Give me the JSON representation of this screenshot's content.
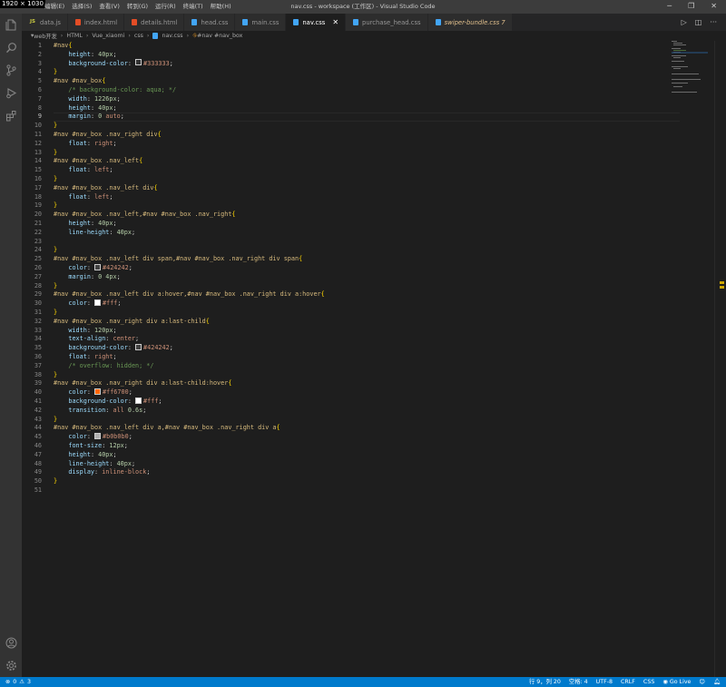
{
  "titlebar": {
    "dims_badge": "1920 × 1030",
    "menu": [
      "编辑(E)",
      "选择(S)",
      "查看(V)",
      "转到(G)",
      "运行(R)",
      "终端(T)",
      "帮助(H)"
    ],
    "window_title": "nav.css - workspace (工作区) - Visual Studio Code"
  },
  "tabs": [
    {
      "label": "data.js",
      "type": "js"
    },
    {
      "label": "index.html",
      "type": "html"
    },
    {
      "label": "details.html",
      "type": "html"
    },
    {
      "label": "head.css",
      "type": "css"
    },
    {
      "label": "main.css",
      "type": "css"
    },
    {
      "label": "nav.css",
      "type": "css",
      "active": true
    },
    {
      "label": "purchase_head.css",
      "type": "css"
    },
    {
      "label": "swiper-bundle.css 7",
      "type": "css",
      "modified": true
    }
  ],
  "breadcrumb": [
    "web开发",
    "HTML",
    "Vue_xiaomi",
    "css",
    "nav.css",
    "#nav #nav_box"
  ],
  "editor": {
    "current_line": 9,
    "lines": [
      [
        [
          "sel",
          "#nav"
        ],
        [
          "br",
          "{"
        ]
      ],
      [
        [
          "p",
          "    "
        ],
        [
          "prop",
          "height"
        ],
        [
          "p",
          ": "
        ],
        [
          "num",
          "40px"
        ],
        [
          "p",
          ";"
        ]
      ],
      [
        [
          "p",
          "    "
        ],
        [
          "prop",
          "background-color"
        ],
        [
          "p",
          ": "
        ],
        [
          "sw",
          "#333333"
        ],
        [
          "kw",
          "#333333"
        ],
        [
          "p",
          ";"
        ]
      ],
      [
        [
          "br",
          "}"
        ]
      ],
      [
        [
          "sel",
          "#nav #nav_box"
        ],
        [
          "br",
          "{"
        ]
      ],
      [
        [
          "p",
          "    "
        ],
        [
          "com",
          "/* background-color: aqua; */"
        ]
      ],
      [
        [
          "p",
          "    "
        ],
        [
          "prop",
          "width"
        ],
        [
          "p",
          ": "
        ],
        [
          "num",
          "1226px"
        ],
        [
          "p",
          ";"
        ]
      ],
      [
        [
          "p",
          "    "
        ],
        [
          "prop",
          "height"
        ],
        [
          "p",
          ": "
        ],
        [
          "num",
          "40px"
        ],
        [
          "p",
          ";"
        ]
      ],
      [
        [
          "p",
          "    "
        ],
        [
          "prop",
          "margin"
        ],
        [
          "p",
          ": "
        ],
        [
          "num",
          "0"
        ],
        [
          "p",
          " "
        ],
        [
          "kw",
          "auto"
        ],
        [
          "p",
          ";"
        ]
      ],
      [
        [
          "br",
          "}"
        ]
      ],
      [
        [
          "sel",
          "#nav #nav_box .nav_right div"
        ],
        [
          "br",
          "{"
        ]
      ],
      [
        [
          "p",
          "    "
        ],
        [
          "prop",
          "float"
        ],
        [
          "p",
          ": "
        ],
        [
          "kw",
          "right"
        ],
        [
          "p",
          ";"
        ]
      ],
      [
        [
          "br",
          "}"
        ]
      ],
      [
        [
          "sel",
          "#nav #nav_box .nav_left"
        ],
        [
          "br",
          "{"
        ]
      ],
      [
        [
          "p",
          "    "
        ],
        [
          "prop",
          "float"
        ],
        [
          "p",
          ": "
        ],
        [
          "kw",
          "left"
        ],
        [
          "p",
          ";"
        ]
      ],
      [
        [
          "br",
          "}"
        ]
      ],
      [
        [
          "sel",
          "#nav #nav_box .nav_left div"
        ],
        [
          "br",
          "{"
        ]
      ],
      [
        [
          "p",
          "    "
        ],
        [
          "prop",
          "float"
        ],
        [
          "p",
          ": "
        ],
        [
          "kw",
          "left"
        ],
        [
          "p",
          ";"
        ]
      ],
      [
        [
          "br",
          "}"
        ]
      ],
      [
        [
          "sel",
          "#nav #nav_box .nav_left,#nav #nav_box .nav_right"
        ],
        [
          "br",
          "{"
        ]
      ],
      [
        [
          "p",
          "    "
        ],
        [
          "prop",
          "height"
        ],
        [
          "p",
          ": "
        ],
        [
          "num",
          "40px"
        ],
        [
          "p",
          ";"
        ]
      ],
      [
        [
          "p",
          "    "
        ],
        [
          "prop",
          "line-height"
        ],
        [
          "p",
          ": "
        ],
        [
          "num",
          "40px"
        ],
        [
          "p",
          ";"
        ]
      ],
      [],
      [
        [
          "br",
          "}"
        ]
      ],
      [
        [
          "sel",
          "#nav #nav_box .nav_left div span,#nav #nav_box .nav_right div span"
        ],
        [
          "br",
          "{"
        ]
      ],
      [
        [
          "p",
          "    "
        ],
        [
          "prop",
          "color"
        ],
        [
          "p",
          ": "
        ],
        [
          "sw",
          "#424242"
        ],
        [
          "kw",
          "#424242"
        ],
        [
          "p",
          ";"
        ]
      ],
      [
        [
          "p",
          "    "
        ],
        [
          "prop",
          "margin"
        ],
        [
          "p",
          ": "
        ],
        [
          "num",
          "0 4px"
        ],
        [
          "p",
          ";"
        ]
      ],
      [
        [
          "br",
          "}"
        ]
      ],
      [
        [
          "sel",
          "#nav #nav_box .nav_left div a:hover,#nav #nav_box .nav_right div a:hover"
        ],
        [
          "br",
          "{"
        ]
      ],
      [
        [
          "p",
          "    "
        ],
        [
          "prop",
          "color"
        ],
        [
          "p",
          ": "
        ],
        [
          "sw",
          "#ffffff"
        ],
        [
          "kw",
          "#fff"
        ],
        [
          "p",
          ";"
        ]
      ],
      [
        [
          "br",
          "}"
        ]
      ],
      [
        [
          "sel",
          "#nav #nav_box .nav_right div a:last-child"
        ],
        [
          "br",
          "{"
        ]
      ],
      [
        [
          "p",
          "    "
        ],
        [
          "prop",
          "width"
        ],
        [
          "p",
          ": "
        ],
        [
          "num",
          "120px"
        ],
        [
          "p",
          ";"
        ]
      ],
      [
        [
          "p",
          "    "
        ],
        [
          "prop",
          "text-align"
        ],
        [
          "p",
          ": "
        ],
        [
          "kw",
          "center"
        ],
        [
          "p",
          ";"
        ]
      ],
      [
        [
          "p",
          "    "
        ],
        [
          "prop",
          "background-color"
        ],
        [
          "p",
          ": "
        ],
        [
          "sw",
          "#424242"
        ],
        [
          "kw",
          "#424242"
        ],
        [
          "p",
          ";"
        ]
      ],
      [
        [
          "p",
          "    "
        ],
        [
          "prop",
          "float"
        ],
        [
          "p",
          ": "
        ],
        [
          "kw",
          "right"
        ],
        [
          "p",
          ";"
        ]
      ],
      [
        [
          "p",
          "    "
        ],
        [
          "com",
          "/* overflow: hidden; */"
        ]
      ],
      [
        [
          "br",
          "}"
        ]
      ],
      [
        [
          "sel",
          "#nav #nav_box .nav_right div a:last-child:hover"
        ],
        [
          "br",
          "{"
        ]
      ],
      [
        [
          "p",
          "    "
        ],
        [
          "prop",
          "color"
        ],
        [
          "p",
          ": "
        ],
        [
          "sw",
          "#ff6700"
        ],
        [
          "kw",
          "#ff6700"
        ],
        [
          "p",
          ";"
        ]
      ],
      [
        [
          "p",
          "    "
        ],
        [
          "prop",
          "background-color"
        ],
        [
          "p",
          ": "
        ],
        [
          "sw",
          "#ffffff"
        ],
        [
          "kw",
          "#fff"
        ],
        [
          "p",
          ";"
        ]
      ],
      [
        [
          "p",
          "    "
        ],
        [
          "prop",
          "transition"
        ],
        [
          "p",
          ": "
        ],
        [
          "kw",
          "all "
        ],
        [
          "num",
          "0.6s"
        ],
        [
          "p",
          ";"
        ]
      ],
      [
        [
          "br",
          "}"
        ]
      ],
      [
        [
          "sel",
          "#nav #nav_box .nav_left div a,#nav #nav_box .nav_right div a"
        ],
        [
          "br",
          "{"
        ]
      ],
      [
        [
          "p",
          "    "
        ],
        [
          "prop",
          "color"
        ],
        [
          "p",
          ": "
        ],
        [
          "sw",
          "#b0b0b0"
        ],
        [
          "kw",
          "#b0b0b0"
        ],
        [
          "p",
          ";"
        ]
      ],
      [
        [
          "p",
          "    "
        ],
        [
          "prop",
          "font-size"
        ],
        [
          "p",
          ": "
        ],
        [
          "num",
          "12px"
        ],
        [
          "p",
          ";"
        ]
      ],
      [
        [
          "p",
          "    "
        ],
        [
          "prop",
          "height"
        ],
        [
          "p",
          ": "
        ],
        [
          "num",
          "40px"
        ],
        [
          "p",
          ";"
        ]
      ],
      [
        [
          "p",
          "    "
        ],
        [
          "prop",
          "line-height"
        ],
        [
          "p",
          ": "
        ],
        [
          "num",
          "40px"
        ],
        [
          "p",
          ";"
        ]
      ],
      [
        [
          "p",
          "    "
        ],
        [
          "prop",
          "display"
        ],
        [
          "p",
          ": "
        ],
        [
          "kw",
          "inline-block"
        ],
        [
          "p",
          ";"
        ]
      ],
      [
        [
          "br",
          "}"
        ]
      ],
      []
    ]
  },
  "statusbar": {
    "errors": "0",
    "warnings": "3",
    "position": "行 9，列 20",
    "spaces": "空格: 4",
    "encoding": "UTF-8",
    "eol": "CRLF",
    "language": "CSS",
    "golive": "Go Live"
  },
  "colors": {
    "accent": "#007acc",
    "editor_bg": "#1e1e1e",
    "activity_bg": "#333333"
  }
}
